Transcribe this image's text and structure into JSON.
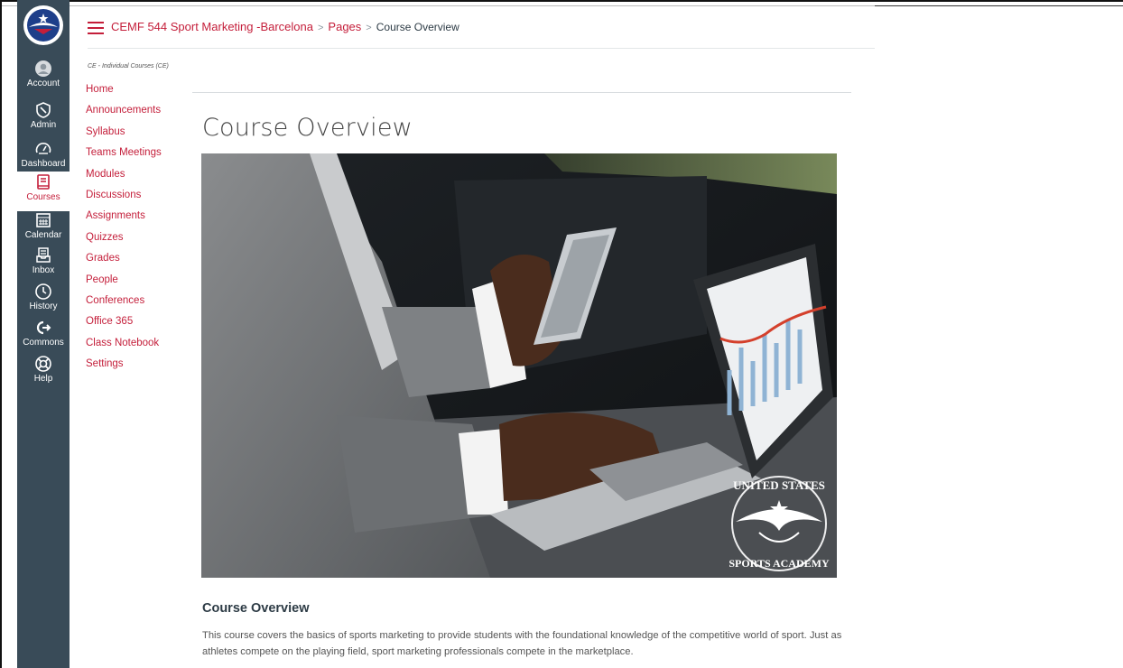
{
  "global_nav": {
    "logo_text_top": "UNITED STATES",
    "logo_text_bottom": "SPORTS ACADEMY",
    "items": [
      {
        "label": "Account",
        "icon": "user-avatar-icon"
      },
      {
        "label": "Admin",
        "icon": "shield-icon"
      },
      {
        "label": "Dashboard",
        "icon": "speedometer-icon"
      },
      {
        "label": "Courses",
        "icon": "book-icon",
        "active": true
      },
      {
        "label": "Calendar",
        "icon": "calendar-icon"
      },
      {
        "label": "Inbox",
        "icon": "inbox-icon"
      },
      {
        "label": "History",
        "icon": "clock-icon"
      },
      {
        "label": "Commons",
        "icon": "commons-arrow-icon"
      },
      {
        "label": "Help",
        "icon": "lifebuoy-icon"
      }
    ]
  },
  "breadcrumb": {
    "course": "CEMF 544 Sport Marketing -Barcelona",
    "separator": ">",
    "pages": "Pages",
    "current": "Course Overview"
  },
  "course_nav": {
    "term": "CE - Individual Courses (CE)",
    "items": [
      "Home",
      "Announcements",
      "Syllabus",
      "Teams Meetings",
      "Modules",
      "Discussions",
      "Assignments",
      "Quizzes",
      "Grades",
      "People",
      "Conferences",
      "Office 365",
      "Class Notebook",
      "Settings"
    ]
  },
  "page": {
    "title": "Course Overview",
    "image_watermark_top": "UNITED STATES",
    "image_watermark_bottom": "SPORTS ACADEMY",
    "section_heading": "Course Overview",
    "body": "This course covers the basics of sports marketing to provide students with the foundational knowledge of the competitive world of sport. Just as athletes compete on the playing field, sport marketing professionals compete in the marketplace."
  },
  "colors": {
    "brand": "#c41e3a",
    "nav_bg": "#394b58",
    "text": "#2d3b45"
  }
}
